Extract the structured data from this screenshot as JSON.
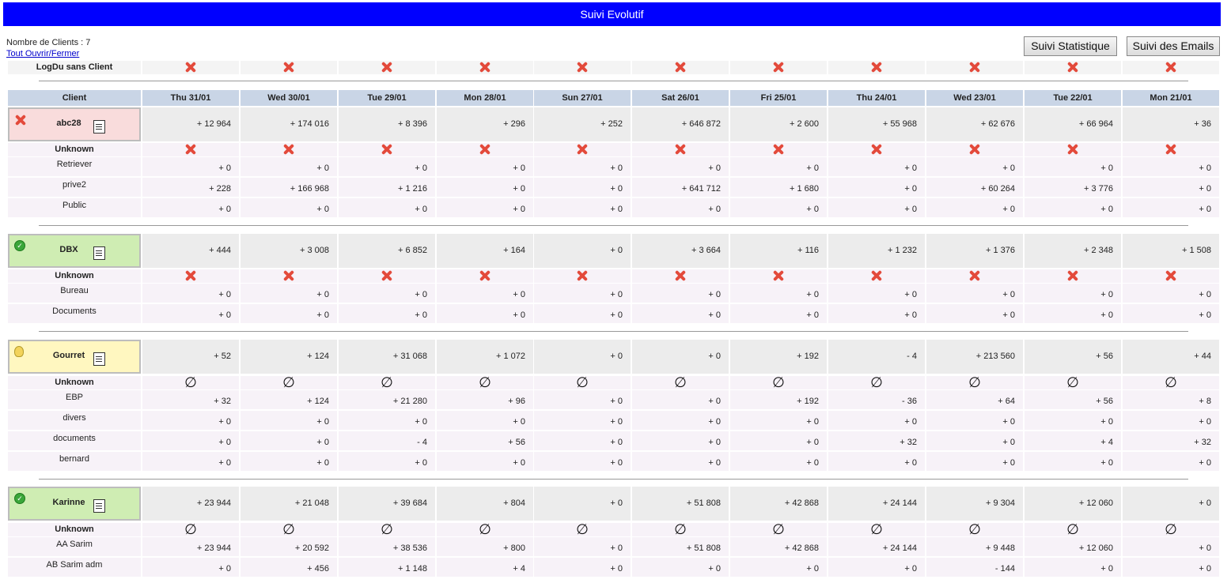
{
  "title": "Suivi Evolutif",
  "meta": {
    "nb_clients": "Nombre de Clients : 7",
    "toggle_all": "Tout Ouvrir/Fermer"
  },
  "buttons": {
    "stat": "Suivi Statistique",
    "emails": "Suivi des Emails"
  },
  "no_client_row": {
    "label": "LogDu sans Client",
    "icon": "red-x-icon"
  },
  "table": {
    "client_header": "Client",
    "days": [
      "Thu 31/01",
      "Wed 30/01",
      "Tue 29/01",
      "Mon 28/01",
      "Sun 27/01",
      "Sat 26/01",
      "Fri 25/01",
      "Thu 24/01",
      "Wed 23/01",
      "Tue 22/01",
      "Mon 21/01"
    ]
  },
  "symbols": {
    "empty": "∅"
  },
  "colors": {
    "title_bg": "#0000ff",
    "header_bg": "#c9d5e6",
    "error": "#f9dcdc",
    "ok": "#cfedb3",
    "warn": "#fff7c0"
  },
  "clients": [
    {
      "name": "abc28",
      "status": "error",
      "status_icon": "red-x-icon",
      "totals": [
        "+ 12 964",
        "+ 174 016",
        "+ 8 396",
        "+ 296",
        "+ 252",
        "+ 646 872",
        "+ 2 600",
        "+ 55 968",
        "+ 62 676",
        "+ 66 964",
        "+ 36"
      ],
      "unknown_label": "Unknown",
      "unknown_icon": "red-x-icon",
      "rows": [
        {
          "label": "Retriever",
          "values": [
            "+ 0",
            "+ 0",
            "+ 0",
            "+ 0",
            "+ 0",
            "+ 0",
            "+ 0",
            "+ 0",
            "+ 0",
            "+ 0",
            "+ 0"
          ]
        },
        {
          "label": "prive2",
          "values": [
            "+ 228",
            "+ 166 968",
            "+ 1 216",
            "+ 0",
            "+ 0",
            "+ 641 712",
            "+ 1 680",
            "+ 0",
            "+ 60 264",
            "+ 3 776",
            "+ 0"
          ]
        },
        {
          "label": "Public",
          "values": [
            "+ 0",
            "+ 0",
            "+ 0",
            "+ 0",
            "+ 0",
            "+ 0",
            "+ 0",
            "+ 0",
            "+ 0",
            "+ 0",
            "+ 0"
          ]
        }
      ]
    },
    {
      "name": "DBX",
      "status": "ok",
      "status_icon": "green-check-icon",
      "totals": [
        "+ 444",
        "+ 3 008",
        "+ 6 852",
        "+ 164",
        "+ 0",
        "+ 3 664",
        "+ 116",
        "+ 1 232",
        "+ 1 376",
        "+ 2 348",
        "+ 1 508"
      ],
      "unknown_label": "Unknown",
      "unknown_icon": "red-x-icon",
      "rows": [
        {
          "label": "Bureau",
          "values": [
            "+ 0",
            "+ 0",
            "+ 0",
            "+ 0",
            "+ 0",
            "+ 0",
            "+ 0",
            "+ 0",
            "+ 0",
            "+ 0",
            "+ 0"
          ]
        },
        {
          "label": "Documents",
          "values": [
            "+ 0",
            "+ 0",
            "+ 0",
            "+ 0",
            "+ 0",
            "+ 0",
            "+ 0",
            "+ 0",
            "+ 0",
            "+ 0",
            "+ 0"
          ]
        }
      ]
    },
    {
      "name": "Gourret",
      "status": "warn",
      "status_icon": "lightbulb-icon",
      "totals": [
        "+ 52",
        "+ 124",
        "+ 31 068",
        "+ 1 072",
        "+ 0",
        "+ 0",
        "+ 192",
        "- 4",
        "+ 213 560",
        "+ 56",
        "+ 44"
      ],
      "unknown_label": "Unknown",
      "unknown_icon": "empty-set-icon",
      "rows": [
        {
          "label": "EBP",
          "values": [
            "+ 32",
            "+ 124",
            "+ 21 280",
            "+ 96",
            "+ 0",
            "+ 0",
            "+ 192",
            "- 36",
            "+ 64",
            "+ 56",
            "+ 8"
          ]
        },
        {
          "label": "divers",
          "values": [
            "+ 0",
            "+ 0",
            "+ 0",
            "+ 0",
            "+ 0",
            "+ 0",
            "+ 0",
            "+ 0",
            "+ 0",
            "+ 0",
            "+ 0"
          ]
        },
        {
          "label": "documents",
          "values": [
            "+ 0",
            "+ 0",
            "- 4",
            "+ 56",
            "+ 0",
            "+ 0",
            "+ 0",
            "+ 32",
            "+ 0",
            "+ 4",
            "+ 32"
          ]
        },
        {
          "label": "bernard",
          "values": [
            "+ 0",
            "+ 0",
            "+ 0",
            "+ 0",
            "+ 0",
            "+ 0",
            "+ 0",
            "+ 0",
            "+ 0",
            "+ 0",
            "+ 0"
          ]
        }
      ]
    },
    {
      "name": "Karinne",
      "status": "ok",
      "status_icon": "green-check-icon",
      "totals": [
        "+ 23 944",
        "+ 21 048",
        "+ 39 684",
        "+ 804",
        "+ 0",
        "+ 51 808",
        "+ 42 868",
        "+ 24 144",
        "+ 9 304",
        "+ 12 060",
        "+ 0"
      ],
      "unknown_label": "Unknown",
      "unknown_icon": "empty-set-icon",
      "rows": [
        {
          "label": "AA Sarim",
          "values": [
            "+ 23 944",
            "+ 20 592",
            "+ 38 536",
            "+ 800",
            "+ 0",
            "+ 51 808",
            "+ 42 868",
            "+ 24 144",
            "+ 9 448",
            "+ 12 060",
            "+ 0"
          ]
        },
        {
          "label": "AB Sarim adm",
          "values": [
            "+ 0",
            "+ 456",
            "+ 1 148",
            "+ 4",
            "+ 0",
            "+ 0",
            "+ 0",
            "+ 0",
            "- 144",
            "+ 0",
            "+ 0"
          ]
        }
      ]
    }
  ]
}
